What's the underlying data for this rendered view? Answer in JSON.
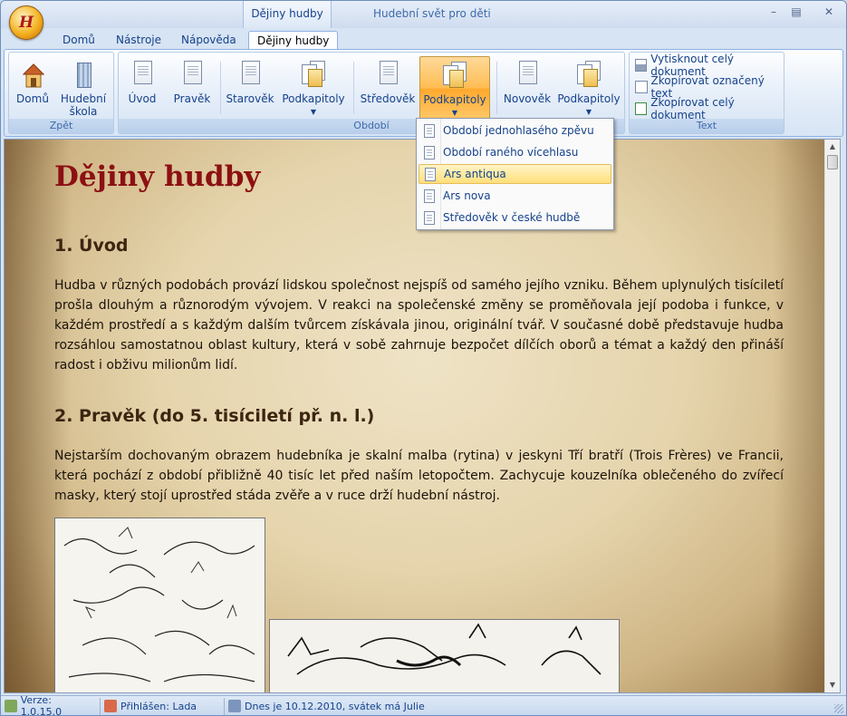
{
  "window": {
    "title": "Hudební svět pro děti",
    "context_tab": "Dějiny hudby",
    "app_button_glyph": "H"
  },
  "tabs": [
    "Domů",
    "Nástroje",
    "Nápověda",
    "Dějiny hudby"
  ],
  "active_tab": "Dějiny hudby",
  "ribbon": {
    "groups": {
      "zpet": {
        "label": "Zpět",
        "buttons": [
          {
            "label": "Domů",
            "icon": "house-icon"
          },
          {
            "label": "Hudební škola",
            "icon": "building-icon"
          }
        ]
      },
      "obdobi": {
        "label": "Období",
        "buttons": [
          {
            "label": "Úvod",
            "icon": "document-icon"
          },
          {
            "label": "Pravěk",
            "icon": "document-icon"
          },
          {
            "label": "Starověk",
            "icon": "document-icon"
          },
          {
            "label": "Podkapitoly",
            "icon": "documents-icon"
          },
          {
            "label": "Středověk",
            "icon": "document-icon"
          },
          {
            "label": "Podkapitoly",
            "icon": "documents-icon"
          },
          {
            "label": "Novověk",
            "icon": "document-icon"
          },
          {
            "label": "Podkapitoly",
            "icon": "documents-icon"
          }
        ]
      },
      "text": {
        "label": "Text",
        "buttons": [
          {
            "label": "Vytisknout celý dokument",
            "icon": "printer-icon"
          },
          {
            "label": "Zkopírovat označený text",
            "icon": "copy-icon"
          },
          {
            "label": "Zkopírovat celý dokument",
            "icon": "copy-all-icon"
          }
        ]
      }
    }
  },
  "dropdown": {
    "items": [
      "Období jednohlasého zpěvu",
      "Období raného vícehlasu",
      "Ars antiqua",
      "Ars nova",
      "Středověk v české hudbě"
    ],
    "highlighted": "Ars antiqua"
  },
  "document": {
    "title": "Dějiny hudby",
    "sections": [
      {
        "heading": "1. Úvod",
        "text": "Hudba v různých podobách provází lidskou společnost nejspíš od samého jejího vzniku. Během uplynulých tisíciletí prošla dlouhým a různorodým vývojem. V reakci na společenské změny se proměňovala její podoba i funkce, v každém prostředí a s každým dalším tvůrcem získávala jinou, originální tvář. V současné době představuje hudba rozsáhlou samostatnou oblast kultury, která v sobě zahrnuje bezpočet dílčích oborů a témat a každý den přináší radost i obživu milionům lidí."
      },
      {
        "heading": "2. Pravěk (do 5. tisíciletí př. n. l.)",
        "text": "Nejstarším dochovaným obrazem hudebníka je skalní malba (rytina) v jeskyni Tří bratří (Trois Frères) ve Francii, která pochází z období přibližně 40 tisíc let před naším letopočtem. Zachycuje kouzelníka oblečeného do zvířecí masky, který stojí uprostřed stáda zvěře a v ruce drží hudební nástroj."
      }
    ]
  },
  "status": {
    "version": "Verze: 1.0.15.0",
    "user": "Přihlášen: Lada",
    "date": "Dnes je 10.12.2010, svátek má Julie"
  },
  "colors": {
    "title_red": "#8c1012",
    "ribbon_blue": "#15428b",
    "selected_orange": "#ffbd52"
  }
}
